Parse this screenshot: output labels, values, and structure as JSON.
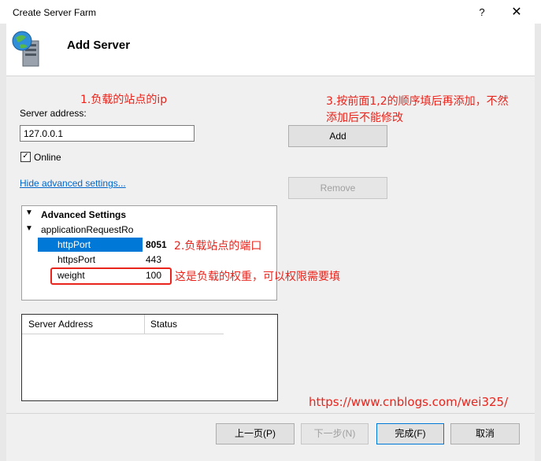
{
  "window": {
    "title": "Create Server Farm",
    "help_label": "?",
    "close_label": "✕"
  },
  "header": {
    "title": "Add Server",
    "icon": "server-globe-icon"
  },
  "annotations": {
    "a1": "1.负载的站点的ip",
    "a3_line1": "3.按前面1,2的顺序填后再添加，不然",
    "a3_line2": "添加后不能修改",
    "a2": "2.负载站点的端口",
    "a_weight": "这是负载的权重，可以权限需要填",
    "url": "https://www.cnblogs.com/wei325/",
    "color": "#e8241c"
  },
  "form": {
    "server_address_label": "Server address:",
    "server_address_value": "127.0.0.1",
    "online_label": "Online",
    "online_checked": "✓",
    "advanced_link": "Hide advanced settings...",
    "add_button": "Add",
    "remove_button": "Remove"
  },
  "tree": {
    "root_label": "Advanced Settings",
    "child_label": "applicationRequestRo",
    "rows": [
      {
        "name": "httpPort",
        "value": "8051"
      },
      {
        "name": "httpsPort",
        "value": "443"
      },
      {
        "name": "weight",
        "value": "100"
      }
    ]
  },
  "grid": {
    "columns": [
      "Server Address",
      "Status"
    ]
  },
  "footer": {
    "prev": "上一页(P)",
    "next": "下一步(N)",
    "finish": "完成(F)",
    "cancel": "取消"
  }
}
